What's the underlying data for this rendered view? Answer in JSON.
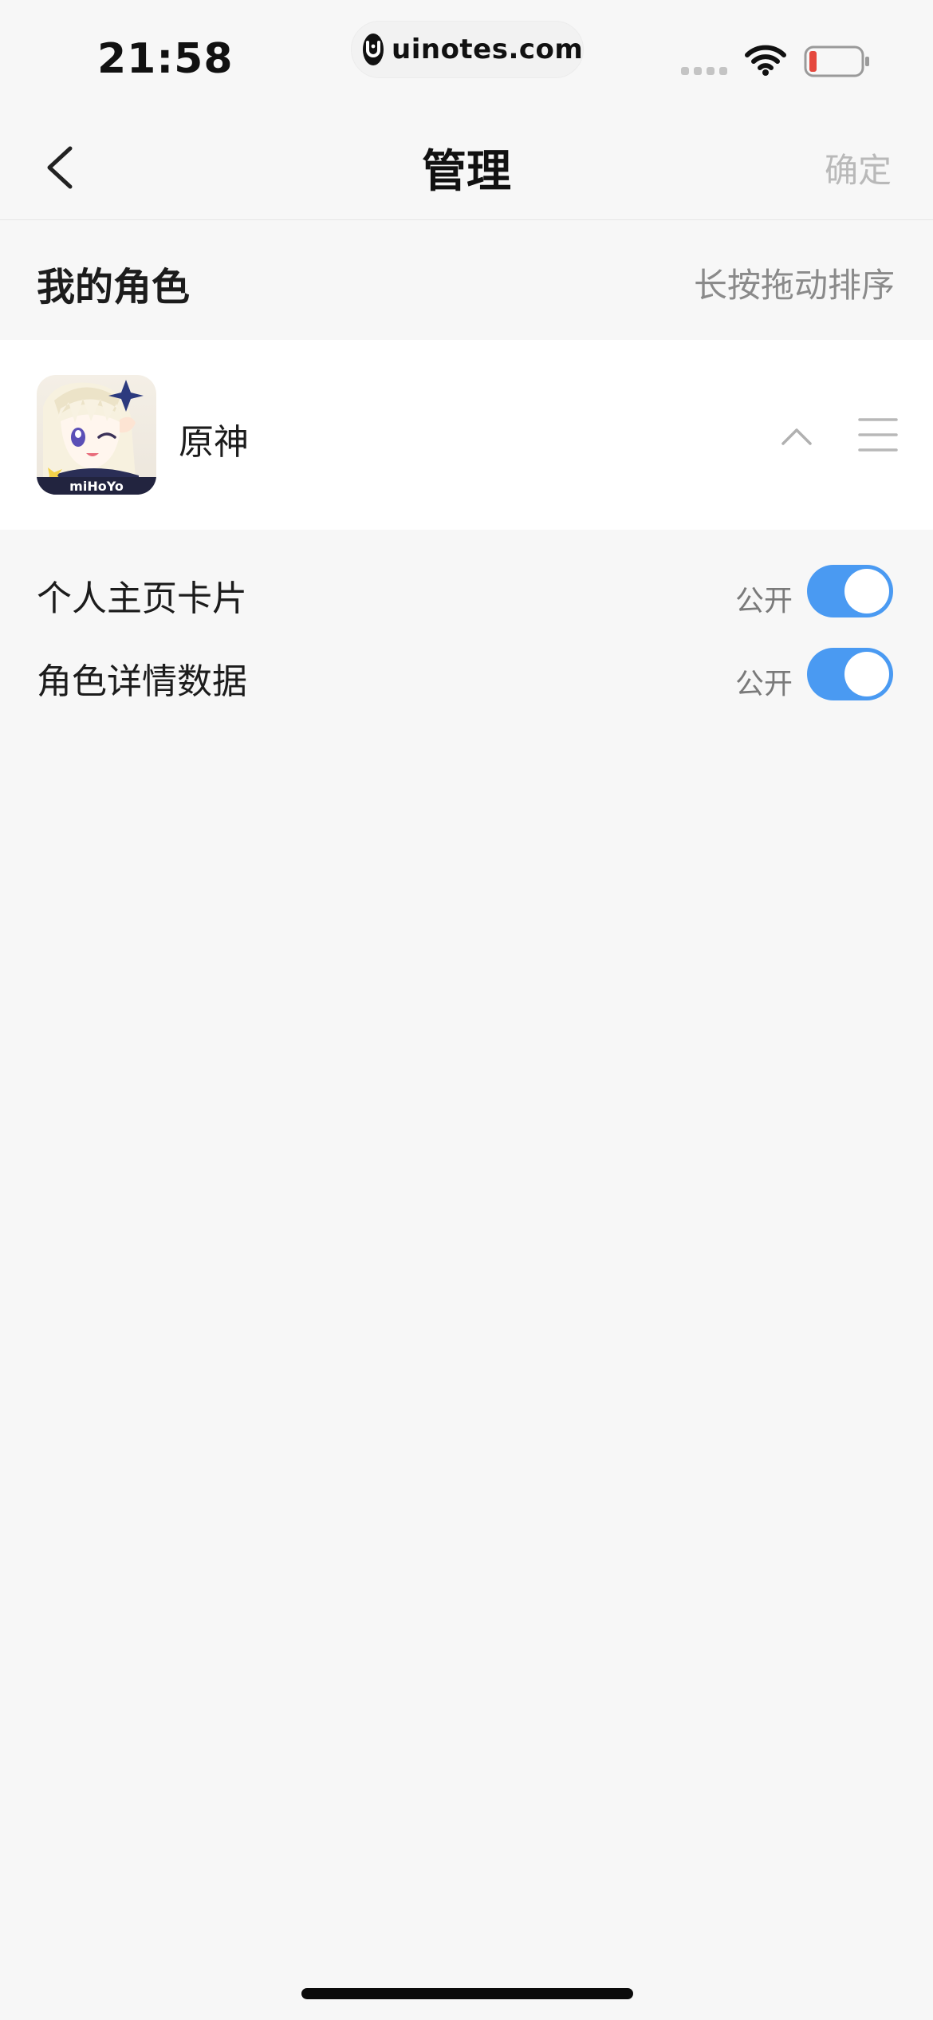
{
  "status_bar": {
    "time": "21:58",
    "url": "uinotes.com",
    "wifi_icon": "wifi-icon",
    "battery_icon": "battery-low-icon",
    "battery_color": "#e5483e"
  },
  "nav": {
    "title": "管理",
    "confirm_label": "确定",
    "back_icon": "chevron-left-icon"
  },
  "section": {
    "title": "我的角色",
    "hint": "长按拖动排序"
  },
  "game": {
    "name": "原神",
    "avatar_caption": "miHoYo",
    "collapse_icon": "chevron-up-icon",
    "drag_icon": "drag-handle-icon"
  },
  "settings": [
    {
      "label": "个人主页卡片",
      "status": "公开",
      "enabled": true
    },
    {
      "label": "角色详情数据",
      "status": "公开",
      "enabled": true
    }
  ],
  "colors": {
    "accent": "#4a9af2",
    "background": "#f7f7f7",
    "card": "#ffffff"
  }
}
